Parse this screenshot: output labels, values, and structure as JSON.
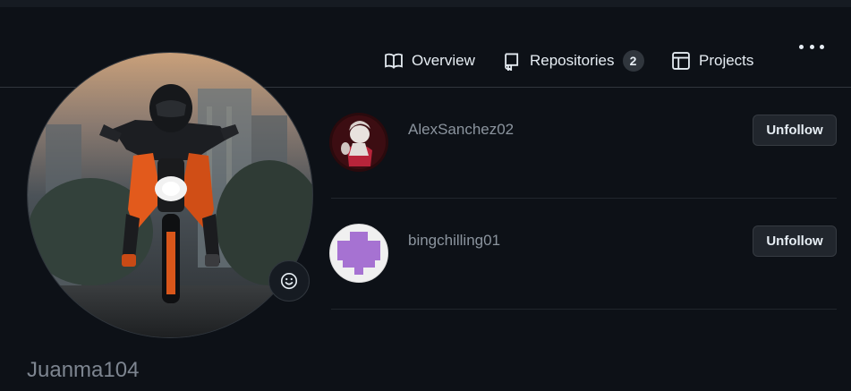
{
  "nav": {
    "overview": {
      "label": "Overview",
      "icon": "book-icon"
    },
    "repositories": {
      "label": "Repositories",
      "count": "2",
      "icon": "repo-icon"
    },
    "projects": {
      "label": "Projects",
      "icon": "table-icon"
    },
    "more_icon": "kebab-horizontal-icon"
  },
  "profile": {
    "username": "Juanma104",
    "status_icon": "smiley-icon"
  },
  "following": [
    {
      "name": "AlexSanchez02",
      "action": "Unfollow"
    },
    {
      "name": "bingchilling01",
      "action": "Unfollow"
    }
  ],
  "colors": {
    "background": "#0d1117",
    "border": "#30363d",
    "text": "#e6edf3",
    "muted": "#7d8590",
    "identicon": "#a672d2"
  }
}
